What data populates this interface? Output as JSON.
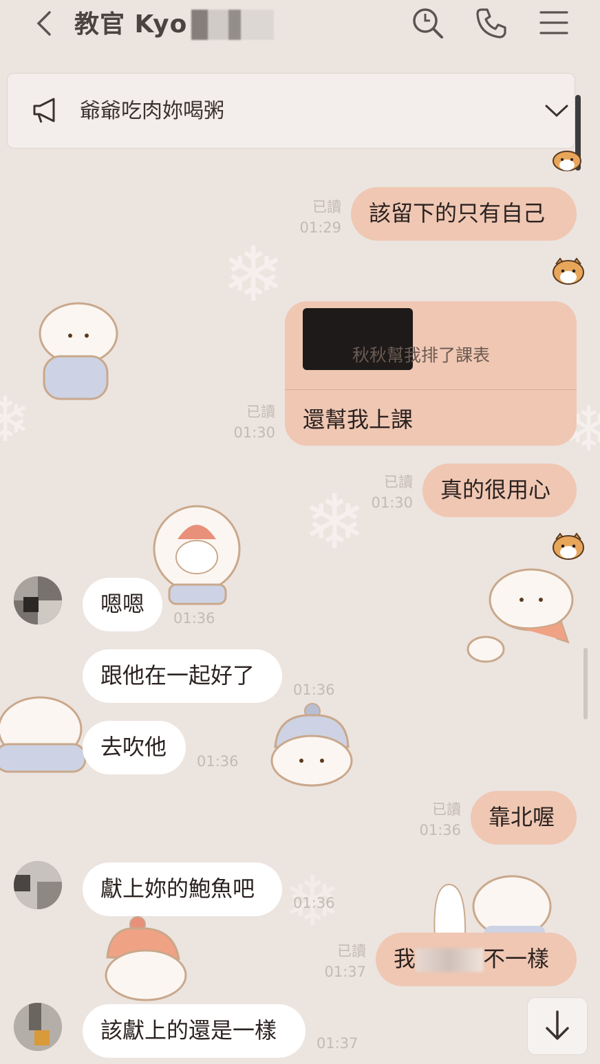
{
  "header": {
    "back_glyph": "‹",
    "title": "教官 Kyo",
    "icons": [
      "search-icon",
      "phone-icon",
      "menu-icon"
    ]
  },
  "announcement": {
    "icon": "megaphone-icon",
    "text": "爺爺吃肉妳喝粥",
    "chevron": "chevron-down-icon"
  },
  "messages": [
    {
      "side": "mine",
      "text": "該留下的只有自己",
      "read": "已讀",
      "time": "01:29"
    },
    {
      "side": "mine",
      "reply_quote": "秋秋幫我排了課表",
      "text": "還幫我上課",
      "read": "已讀",
      "time": "01:30"
    },
    {
      "side": "mine",
      "text": "真的很用心",
      "read": "已讀",
      "time": "01:30"
    },
    {
      "side": "theirs",
      "text": "嗯嗯",
      "time": "01:36"
    },
    {
      "side": "theirs",
      "text": "跟他在一起好了",
      "time": "01:36"
    },
    {
      "side": "theirs",
      "text": "去吹他",
      "time": "01:36"
    },
    {
      "side": "mine",
      "text": "靠北喔",
      "read": "已讀",
      "time": "01:36"
    },
    {
      "side": "theirs",
      "text": "獻上妳的鮑魚吧",
      "time": "01:36"
    },
    {
      "side": "mine",
      "text_start": "我",
      "text_end": "不一樣",
      "read": "已讀",
      "time": "01:37"
    },
    {
      "side": "theirs",
      "text": "該獻上的還是一樣",
      "time": "01:37"
    }
  ],
  "colors": {
    "background": "#ece4df",
    "mine_bubble": "#efc7b3",
    "theirs_bubble": "#ffffff",
    "meta_text": "#c5b9b3"
  },
  "scroll_button_icon": "arrow-down-icon"
}
